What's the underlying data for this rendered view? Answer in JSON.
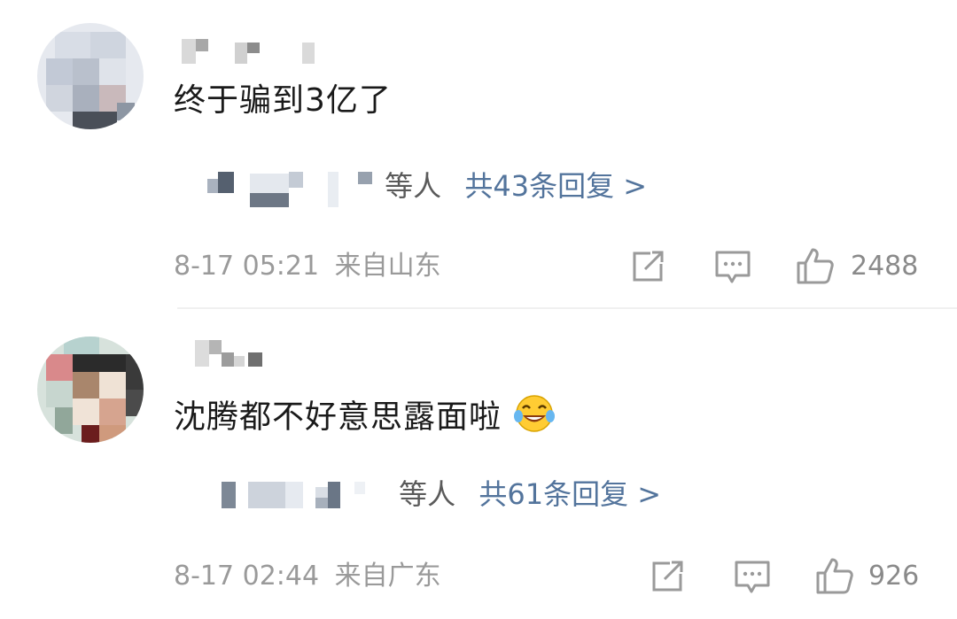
{
  "comments": [
    {
      "text": "终于骗到3亿了",
      "repliers_suffix": "等人",
      "reply_count_label": "共43条回复 >",
      "time": "8-17 05:21",
      "location": "来自山东",
      "like_count": "2488"
    },
    {
      "text": "沈腾都不好意思露面啦",
      "repliers_suffix": "等人",
      "reply_count_label": "共61条回复 >",
      "time": "8-17 02:44",
      "location": "来自广东",
      "like_count": "926",
      "emoji": "laughing-tears-emoji"
    }
  ],
  "icons": {
    "share": "share-icon",
    "reply": "comment-bubble-icon",
    "like": "thumbs-up-icon"
  },
  "colors": {
    "link": "#53749c",
    "meta": "#9a9a9a",
    "text": "#1a1a1a"
  }
}
